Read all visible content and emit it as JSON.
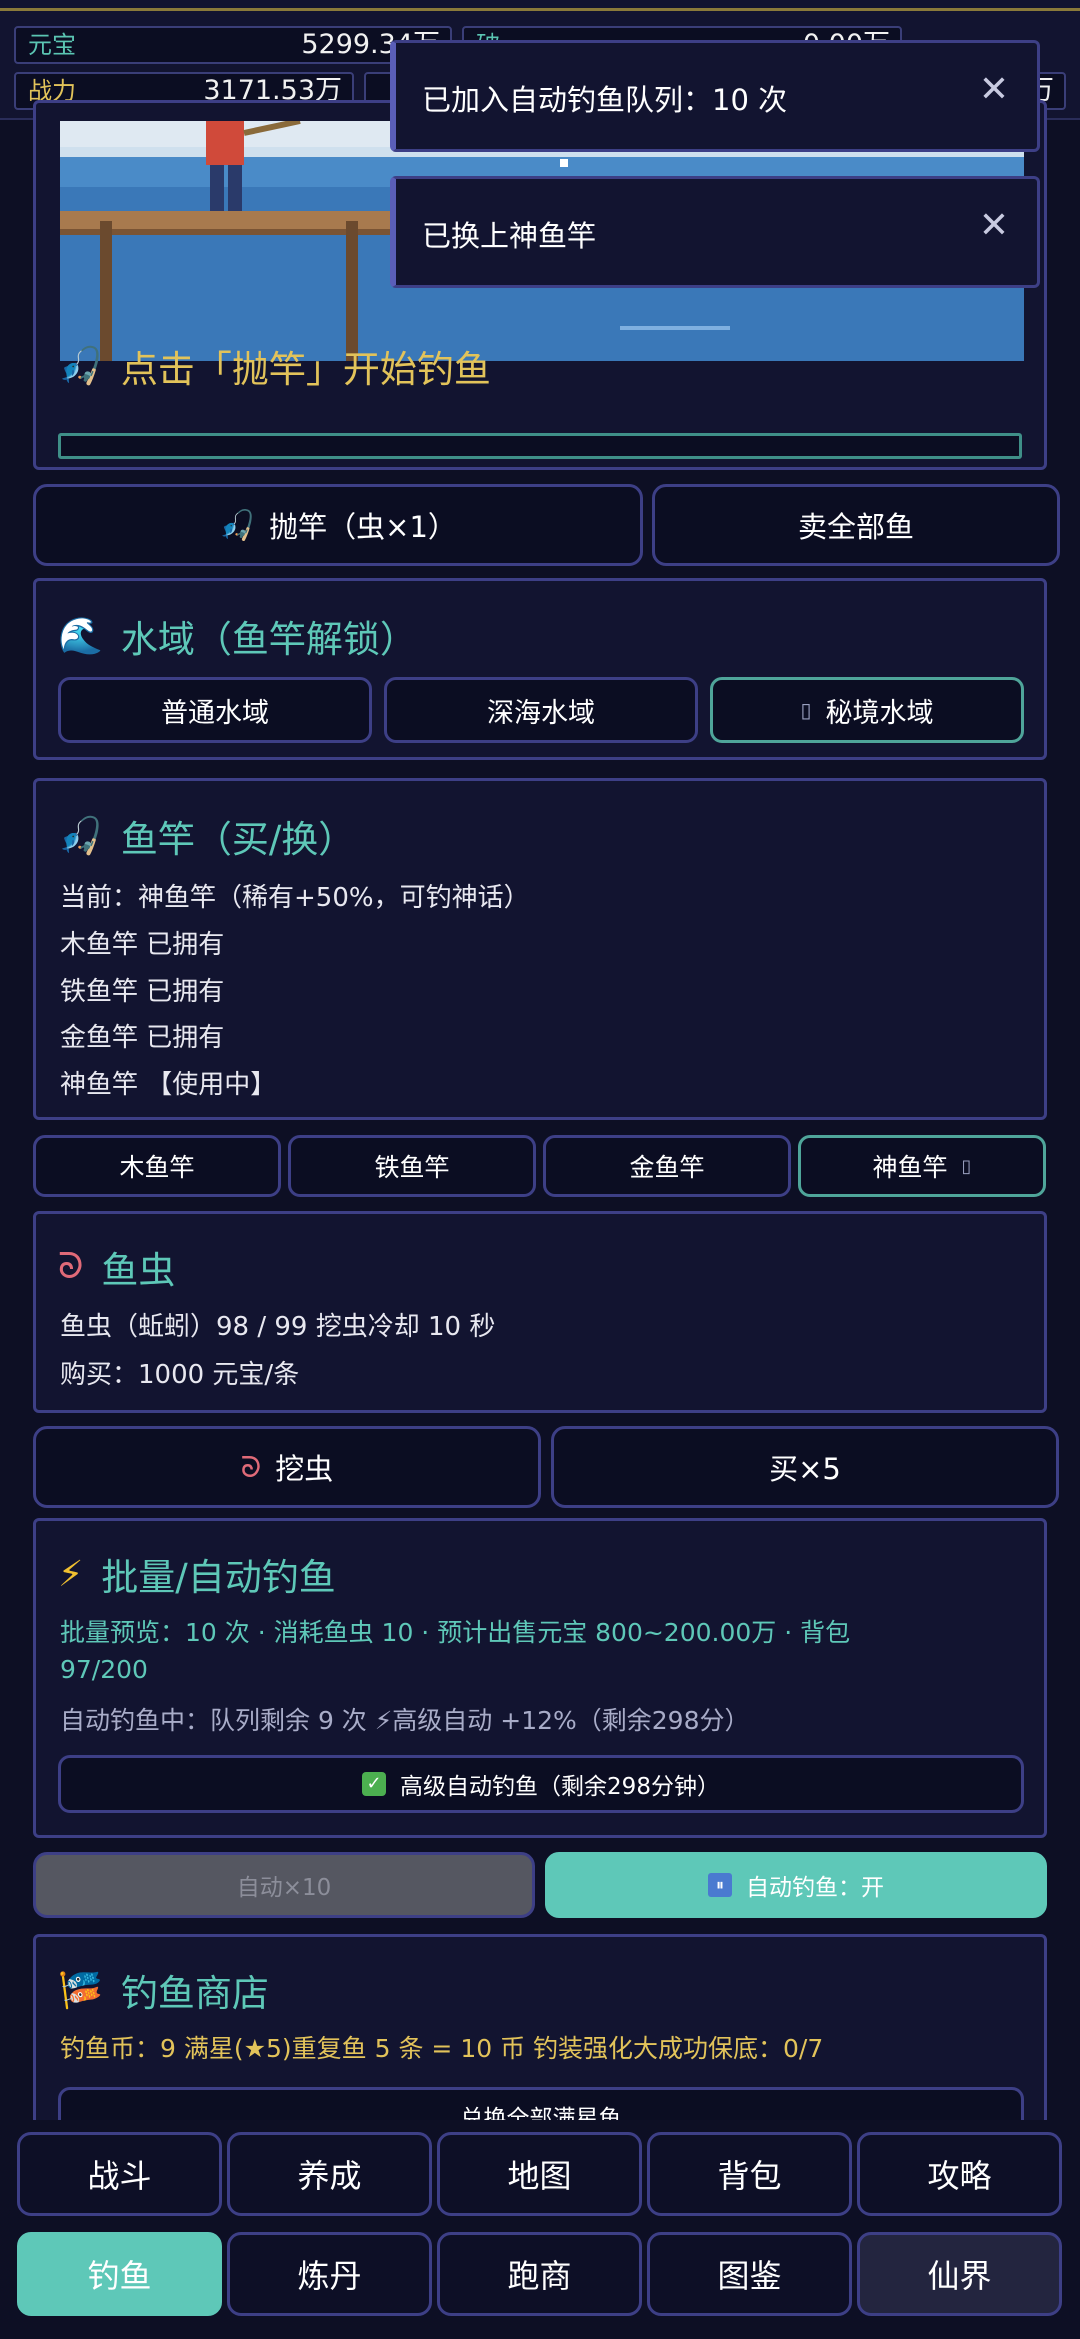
{
  "stats": {
    "yuanbao_label": "元宝",
    "yuanbao_value": "5299.34万",
    "zhanli_label": "战力",
    "zhanli_value": "3171.53万",
    "partial_label_2": "破",
    "partial_label_3": "万",
    "partial_value_2": "0.00万"
  },
  "toasts": [
    {
      "message": "已加入自动钓鱼队列：10 次"
    },
    {
      "message": "已换上神鱼竿"
    }
  ],
  "fishing_scene": {
    "hint": "点击「抛竿」开始钓鱼"
  },
  "actions": {
    "cast_label": "抛竿（虫×1）",
    "sell_all_label": "卖全部鱼"
  },
  "waters": {
    "title": "水域（鱼竿解锁）",
    "options": [
      "普通水域",
      "深海水域",
      "秘境水域"
    ],
    "selected_index": 2
  },
  "rods": {
    "title": "鱼竿（买/换）",
    "current": "当前：神鱼竿（稀有+50%，可钓神话）",
    "list": [
      "木鱼竿 已拥有",
      "铁鱼竿 已拥有",
      "金鱼竿 已拥有",
      "神鱼竿 【使用中】"
    ],
    "buttons": [
      "木鱼竿",
      "铁鱼竿",
      "金鱼竿",
      "神鱼竿 "
    ]
  },
  "bait": {
    "title": "鱼虫",
    "status": "鱼虫（蚯蚓）98 / 99  挖虫冷却 10 秒",
    "price": "购买：1000 元宝/条",
    "dig_label": "挖虫",
    "buy_label": "买×5"
  },
  "auto_fish": {
    "title": "批量/自动钓鱼",
    "preview_line1": "批量预览：10 次 · 消耗鱼虫 10 · 预计出售元宝 800~200.00万 · 背包",
    "preview_line2": "97/200",
    "status": "自动钓鱼中：队列剩余 9 次 ⚡高级自动 +12%（剩余298分）",
    "advanced_toggle": "高级自动钓鱼（剩余298分钟）",
    "auto10_label": "自动×10",
    "auto_on_label": "自动钓鱼：开"
  },
  "shop": {
    "title": "钓鱼商店",
    "info": "钓鱼币：9  满星(★5)重复鱼 5 条 = 10 币  钓装强化大成功保底：0/7",
    "exchange_label": "兑换全部满星鱼"
  },
  "nav": {
    "row1": [
      "战斗",
      "养成",
      "地图",
      "背包",
      "攻略"
    ],
    "row2": [
      "钓鱼",
      "炼丹",
      "跑商",
      "图鉴",
      "仙界"
    ],
    "active": "钓鱼"
  },
  "colors": {
    "accent": "#5ec8b8",
    "gold": "#e2c35a",
    "panel_border": "#3d3f86",
    "background": "#0d0f24"
  }
}
